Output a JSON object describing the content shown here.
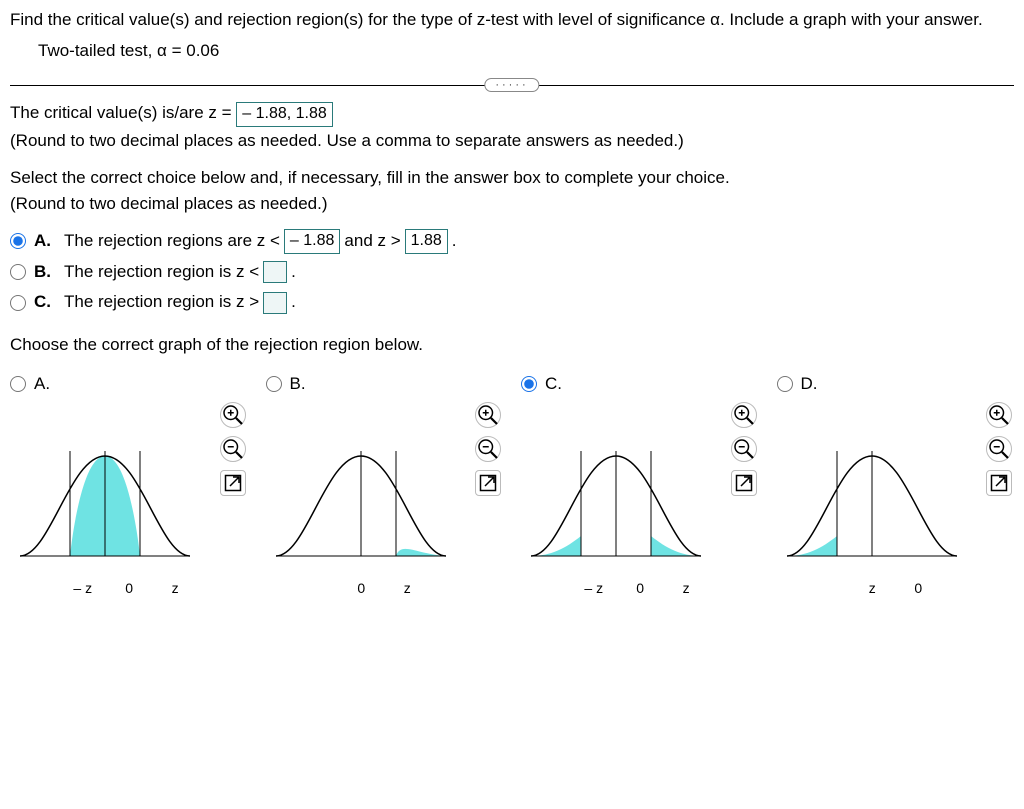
{
  "question": {
    "prompt": "Find the critical value(s) and rejection region(s) for the type of z-test with level of significance α. Include a graph with your answer.",
    "params": "Two-tailed test, α = 0.06"
  },
  "critical": {
    "lead": "The critical value(s) is/are z =",
    "value": "– 1.88, 1.88",
    "hint": "(Round to two decimal places as needed. Use a comma to separate answers as needed.)"
  },
  "select": {
    "instruction": "Select the correct choice below and, if necessary, fill in the answer box to complete your choice.",
    "round_hint": "(Round to two decimal places as needed.)"
  },
  "choices": {
    "A": {
      "pre": "The rejection regions are z <",
      "val1": "– 1.88",
      "mid": "and z >",
      "val2": "1.88",
      "post": "."
    },
    "B": {
      "pre": "The rejection region is z <",
      "post": "."
    },
    "C": {
      "pre": "The rejection region is z >",
      "post": "."
    }
  },
  "graph_prompt": "Choose the correct graph of the rejection region below.",
  "graphs": {
    "A": {
      "labels": [
        "– z",
        "0",
        "z"
      ]
    },
    "B": {
      "labels": [
        "0",
        "z"
      ]
    },
    "C": {
      "labels": [
        "– z",
        "0",
        "z"
      ]
    },
    "D": {
      "labels": [
        "z",
        "0"
      ]
    }
  },
  "letters": {
    "A": "A.",
    "B": "B.",
    "C": "C.",
    "D": "D."
  }
}
